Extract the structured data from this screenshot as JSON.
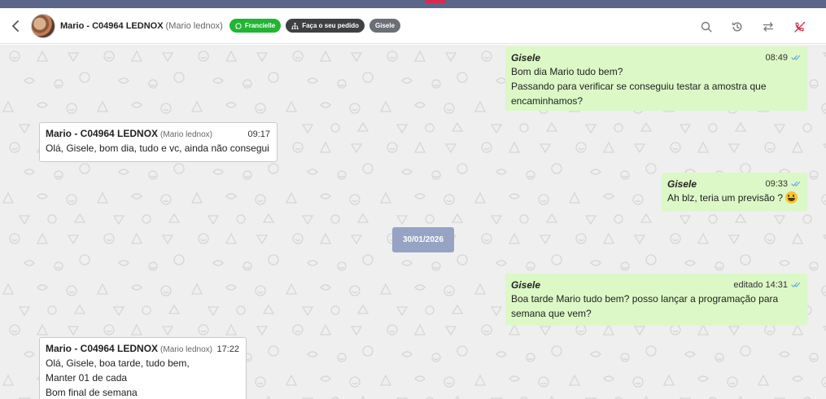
{
  "header": {
    "contact_name": "Mario - C04964 LEDNOX",
    "contact_sub": "(Mario lednox)",
    "tags": {
      "whatsapp": "Francielle",
      "order": "Faça o seu pedido",
      "agent": "Gisele"
    },
    "icons": [
      "back-arrow-icon",
      "search-icon",
      "history-icon",
      "transfer-icon",
      "phone-off-icon"
    ]
  },
  "chat": {
    "messages": [
      {
        "direction": "out",
        "sender": "Gisele",
        "time": "08:49",
        "lines": [
          "Bom dia Mario tudo bem?",
          "Passando para verificar se conseguiu testar a amostra que",
          "encaminhamos?"
        ]
      },
      {
        "direction": "in",
        "sender": "Mario - C04964 LEDNOX",
        "sender_sub": "(Mario lednox)",
        "time": "09:17",
        "lines": [
          "Olá, Gisele, bom dia, tudo e vc, ainda não consegui"
        ]
      },
      {
        "direction": "out",
        "sender": "Gisele",
        "time": "09:33",
        "lines": [
          "Ah blz, teria um previsão ?"
        ]
      },
      {
        "direction": "out",
        "sender": "Gisele",
        "edited": "editado",
        "time": "14:31",
        "lines": [
          "Boa tarde Mario tudo bem? posso lançar a programação para",
          "semana que vem?"
        ]
      },
      {
        "direction": "in",
        "sender": "Mario - C04964 LEDNOX",
        "sender_sub": "(Mario lednox)",
        "time": "17:22",
        "lines": [
          "Olá, Gisele, boa tarde, tudo bem,",
          "Manter 01 de cada",
          "Bom final de semana"
        ]
      }
    ],
    "date_separator": "30/01/2026"
  },
  "colors": {
    "outgoing_bubble": "#dcf8c6",
    "incoming_bubble": "#ffffff",
    "date_chip": "#97a3c4",
    "tag_green": "#22b533",
    "read_ticks": "#53a6e8",
    "hangup_icon": "#d62b4f"
  }
}
